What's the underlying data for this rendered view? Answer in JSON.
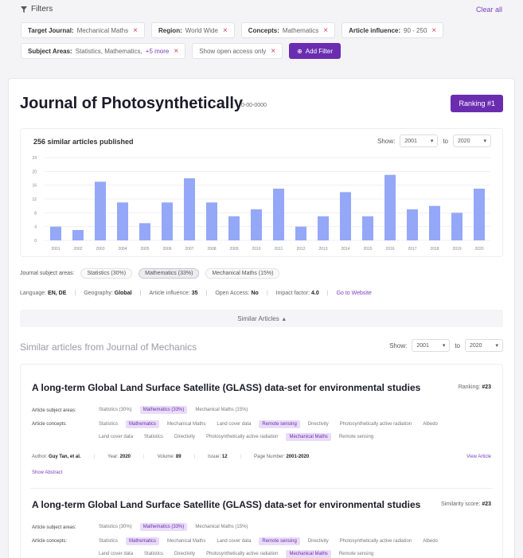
{
  "filters": {
    "heading": "Filters",
    "clear_all": "Clear all",
    "row1": [
      {
        "label": "Target Journal:",
        "value": "Mechanical Maths"
      },
      {
        "label": "Region:",
        "value": "World Wide"
      },
      {
        "label": "Concepts:",
        "value": "Mathematics"
      },
      {
        "label": "Article influence:",
        "value": "90 - 250"
      }
    ],
    "row2": {
      "subject_label": "Subject Areas:",
      "subject_value": "Statistics, Mathematics,",
      "subject_more": "+5 more",
      "open_access": "Show open access only",
      "add_filter": "Add Filter"
    }
  },
  "journal": {
    "title": "Journal of Photosynthetically",
    "issn": "0-00-0000",
    "ranking": "Ranking #1"
  },
  "chart": {
    "title": "256 similar articles published",
    "show_label": "Show:",
    "from": "2001",
    "to_label": "to",
    "to": "2020"
  },
  "chart_data": {
    "type": "bar",
    "categories": [
      "2001",
      "2002",
      "2003",
      "2004",
      "2005",
      "2006",
      "2007",
      "2008",
      "2009",
      "2010",
      "2011",
      "2012",
      "2013",
      "2014",
      "2015",
      "2016",
      "2017",
      "2018",
      "2019",
      "2020"
    ],
    "values": [
      4,
      3,
      17,
      11,
      5,
      11,
      18,
      11,
      7,
      9,
      15,
      4,
      7,
      14,
      7,
      19,
      9,
      10,
      8,
      15
    ],
    "y_ticks": [
      "0",
      "4",
      "8",
      "12",
      "16",
      "20",
      "24"
    ],
    "ylim": [
      0,
      24
    ],
    "color": "#94a8f7"
  },
  "subjects": {
    "label": "Journal subject areas:",
    "tags": [
      "Statistics (30%)",
      "Mathematics (33%)",
      "Mechanical Maths (15%)"
    ]
  },
  "meta": {
    "language_label": "Language:",
    "language": "EN, DE",
    "geography_label": "Geography:",
    "geography": "Global",
    "influence_label": "Article influence:",
    "influence": "35",
    "open_access_label": "Open Access:",
    "open_access": "No",
    "impact_label": "Impact factor:",
    "impact": "4.0",
    "website": "Go to Website"
  },
  "similar_bar": "Similar Articles",
  "section": {
    "title": "Similar articles from Journal of Mechanics",
    "show_label": "Show:",
    "from": "2001",
    "to_label": "to",
    "to": "2020"
  },
  "articles": [
    {
      "title": "A long-term Global Land Surface Satellite (GLASS) data-set for environmental studies",
      "rank_label": "Ranking:",
      "rank": "#23",
      "subject_label": "Article subject areas:",
      "subjects": [
        "Statistics (30%)",
        "Mathematics (33%)",
        "Mechanical Maths (15%)"
      ],
      "concepts_label": "Article concepts:",
      "concepts": [
        "Statistics",
        "Mathematics",
        "Mechanical Maths",
        "Land cover data",
        "Remote sensing",
        "Directivity",
        "Photosynthetically active radiation",
        "Albedo",
        "Land cover data",
        "Statistics",
        "Directivity",
        "Photosynthetically active radiation",
        "Mechanical Maths",
        "Remote sensing"
      ],
      "author_label": "Author:",
      "author": "Guy Tan, et al.",
      "year_label": "Year:",
      "year": "2020",
      "volume_label": "Volume:",
      "volume": "89",
      "issue_label": "Issue:",
      "issue": "12",
      "pages_label": "Page Number:",
      "pages": "2001-2020",
      "view": "View Article",
      "abstract": "Show Abstract"
    },
    {
      "title": "A long-term Global Land Surface Satellite (GLASS) data-set for environmental studies",
      "rank_label": "Similarity score:",
      "rank": "#23",
      "subject_label": "Article subject areas:",
      "subjects": [
        "Statistics (30%)",
        "Mathematics (33%)",
        "Mechanical Maths (15%)"
      ],
      "concepts_label": "Article concepts:",
      "concepts": [
        "Statistics",
        "Mathematics",
        "Mechanical Maths",
        "Land cover data",
        "Remote sensing",
        "Directivity",
        "Photosynthetically active radiation",
        "Albedo",
        "Land cover data",
        "Statistics",
        "Directivity",
        "Photosynthetically active radiation",
        "Mechanical Maths",
        "Remote sensing"
      ]
    }
  ]
}
